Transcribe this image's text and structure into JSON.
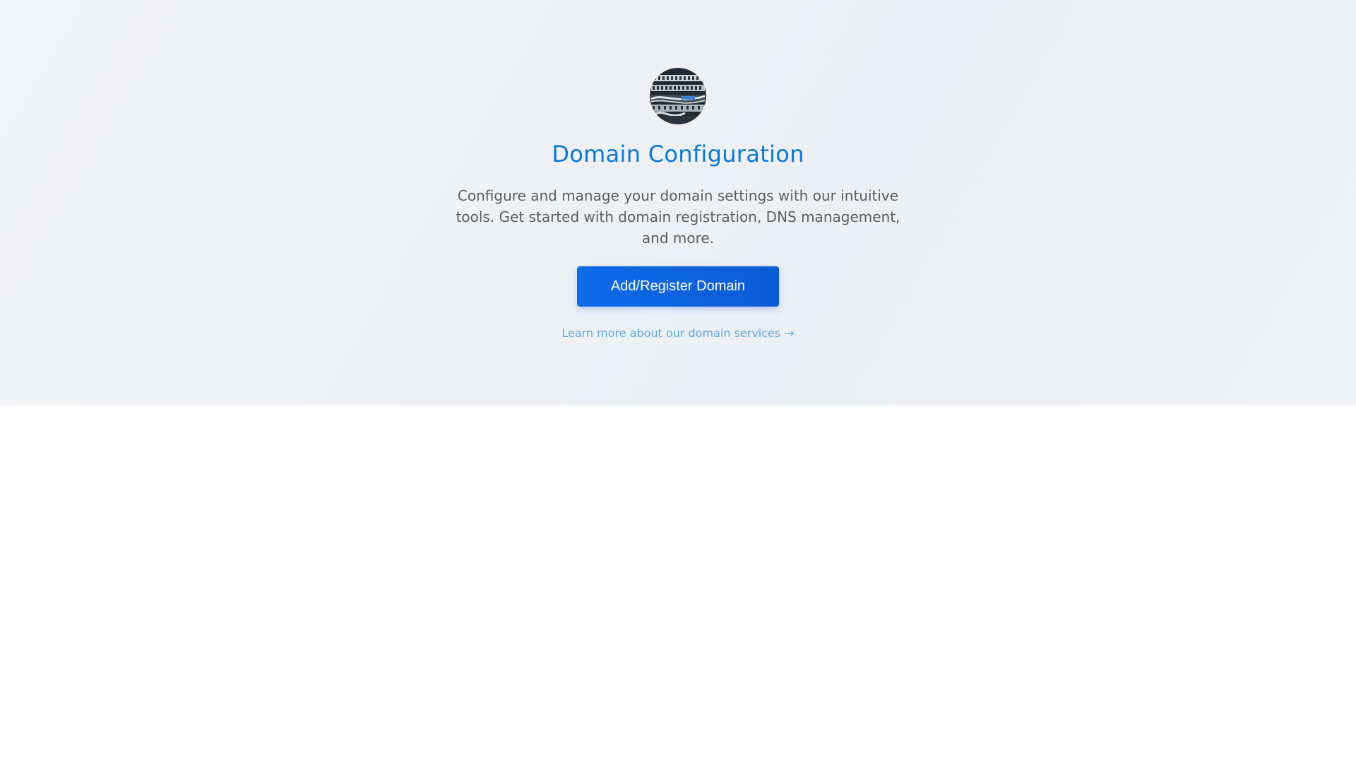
{
  "hero": {
    "avatar_icon": "server-rack-photo-icon",
    "title": "Domain Configuration",
    "description": "Configure and manage your domain settings with our intuitive tools. Get started with domain registration, DNS management, and more.",
    "cta_label": "Add/Register Domain",
    "learn_more_label": "Learn more about our domain services",
    "learn_more_arrow": "→"
  },
  "colors": {
    "title": "#0a78d7",
    "cta_bg_start": "#0f6ae8",
    "cta_bg_end": "#0b5bd6",
    "link": "#5aa8d8",
    "description": "#5a5e63"
  }
}
